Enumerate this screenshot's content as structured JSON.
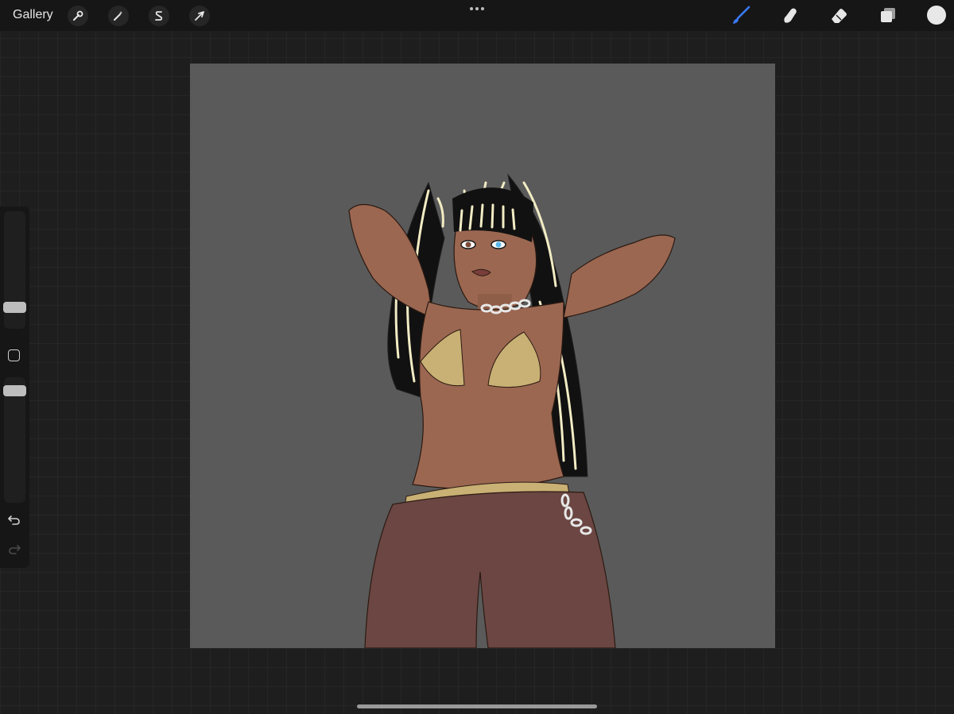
{
  "app": {
    "gallery_label": "Gallery"
  },
  "toolbar": {
    "left_tools": [
      "wrench-icon",
      "magic-wand-icon",
      "selection-s-icon",
      "transform-arrow-icon"
    ],
    "right_tools": [
      "brush-icon",
      "smudge-icon",
      "eraser-icon",
      "layers-icon"
    ],
    "active_tool": "brush-icon",
    "accent_color": "#3a7bff",
    "current_color": "#e8e8e8"
  },
  "sidebar": {
    "brush_size": 0.25,
    "opacity": 1.0,
    "undo_icon": "undo-icon",
    "redo_icon": "redo-icon"
  },
  "canvas": {
    "background_color": "#5a5a5a",
    "artwork": "character-illustration"
  }
}
